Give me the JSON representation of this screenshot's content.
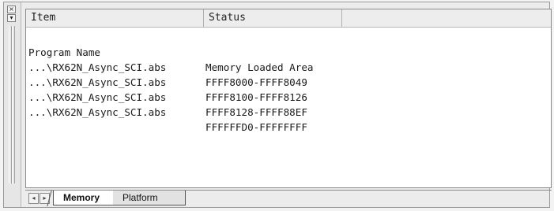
{
  "window": {
    "close_glyph": "×",
    "pin_glyph": "▾"
  },
  "table": {
    "columns": [
      "Item",
      "Status",
      ""
    ],
    "rows": [
      {
        "item": "Program Name",
        "status": "Memory Loaded Area"
      },
      {
        "item": "...\\RX62N_Async_SCI.abs",
        "status": "FFFF8000-FFFF8049"
      },
      {
        "item": "...\\RX62N_Async_SCI.abs",
        "status": "FFFF8100-FFFF8126"
      },
      {
        "item": "...\\RX62N_Async_SCI.abs",
        "status": "FFFF8128-FFFF88EF"
      },
      {
        "item": "...\\RX62N_Async_SCI.abs",
        "status": "FFFFFFD0-FFFFFFFF"
      }
    ]
  },
  "tabs": {
    "prev_glyph": "◂",
    "next_glyph": "▸",
    "items": [
      {
        "label": "Memory",
        "active": true
      },
      {
        "label": "Platform",
        "active": false
      }
    ]
  }
}
